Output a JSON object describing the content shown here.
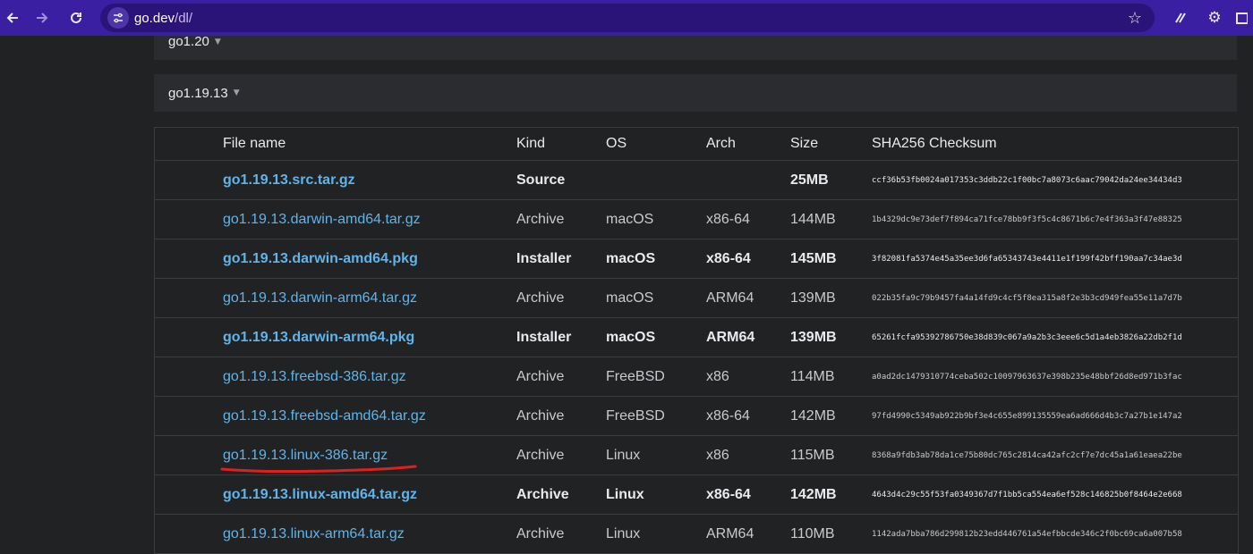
{
  "browser": {
    "url_host": "go.dev",
    "url_path": "/dl/"
  },
  "releases": {
    "prev": "go1.20",
    "current": "go1.19.13"
  },
  "table": {
    "headers": [
      "File name",
      "Kind",
      "OS",
      "Arch",
      "Size",
      "SHA256 Checksum"
    ],
    "rows": [
      {
        "file": "go1.19.13.src.tar.gz",
        "kind": "Source",
        "os": "",
        "arch": "",
        "size": "25MB",
        "sha": "ccf36b53fb0024a017353c3ddb22c1f00bc7a8073c6aac79042da24ee34434d3",
        "bold": true
      },
      {
        "file": "go1.19.13.darwin-amd64.tar.gz",
        "kind": "Archive",
        "os": "macOS",
        "arch": "x86-64",
        "size": "144MB",
        "sha": "1b4329dc9e73def7f894ca71fce78bb9f3f5c4c8671b6c7e4f363a3f47e88325",
        "bold": false
      },
      {
        "file": "go1.19.13.darwin-amd64.pkg",
        "kind": "Installer",
        "os": "macOS",
        "arch": "x86-64",
        "size": "145MB",
        "sha": "3f82081fa5374e45a35ee3d6fa65343743e4411e1f199f42bff190aa7c34ae3d",
        "bold": true
      },
      {
        "file": "go1.19.13.darwin-arm64.tar.gz",
        "kind": "Archive",
        "os": "macOS",
        "arch": "ARM64",
        "size": "139MB",
        "sha": "022b35fa9c79b9457fa4a14fd9c4cf5f8ea315a8f2e3b3cd949fea55e11a7d7b",
        "bold": false
      },
      {
        "file": "go1.19.13.darwin-arm64.pkg",
        "kind": "Installer",
        "os": "macOS",
        "arch": "ARM64",
        "size": "139MB",
        "sha": "65261fcfa95392786750e38d839c067a9a2b3c3eee6c5d1a4eb3826a22db2f1d",
        "bold": true
      },
      {
        "file": "go1.19.13.freebsd-386.tar.gz",
        "kind": "Archive",
        "os": "FreeBSD",
        "arch": "x86",
        "size": "114MB",
        "sha": "a0ad2dc1479310774ceba502c10097963637e398b235e48bbf26d8ed971b3fac",
        "bold": false
      },
      {
        "file": "go1.19.13.freebsd-amd64.tar.gz",
        "kind": "Archive",
        "os": "FreeBSD",
        "arch": "x86-64",
        "size": "142MB",
        "sha": "97fd4990c5349ab922b9bf3e4c655e899135559ea6ad666d4b3c7a27b1e147a2",
        "bold": false
      },
      {
        "file": "go1.19.13.linux-386.tar.gz",
        "kind": "Archive",
        "os": "Linux",
        "arch": "x86",
        "size": "115MB",
        "sha": "8368a9fdb3ab78da1ce75b80dc765c2814ca42afc2cf7e7dc45a1a61eaea22be",
        "bold": false
      },
      {
        "file": "go1.19.13.linux-amd64.tar.gz",
        "kind": "Archive",
        "os": "Linux",
        "arch": "x86-64",
        "size": "142MB",
        "sha": "4643d4c29c55f53fa0349367d7f1bb5ca554ea6ef528c146825b0f8464e2e668",
        "bold": true
      },
      {
        "file": "go1.19.13.linux-arm64.tar.gz",
        "kind": "Archive",
        "os": "Linux",
        "arch": "ARM64",
        "size": "110MB",
        "sha": "1142ada7bba786d299812b23edd446761a54efbbcde346c2f0bc69ca6a007b58",
        "bold": false
      }
    ]
  },
  "colors": {
    "toolbar": "#3b1fa3",
    "link": "#5fb4ea",
    "annotation": "#e0201c"
  },
  "icons": [
    "back-arrow-icon",
    "forward-arrow-icon",
    "reload-icon",
    "site-settings-icon",
    "star-icon",
    "extension-icon",
    "gear-icon",
    "puzzle-icon"
  ]
}
